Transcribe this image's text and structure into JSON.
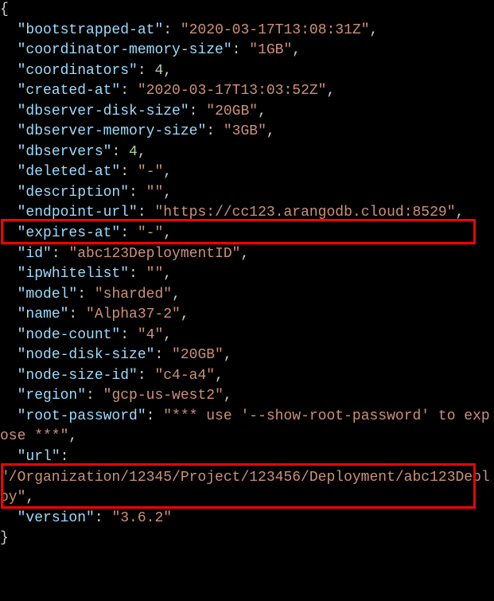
{
  "lines": [
    {
      "type": "brace",
      "text": "{"
    },
    {
      "type": "kv_str",
      "indent": "  ",
      "key": "bootstrapped-at",
      "value": "2020-03-17T13:08:31Z",
      "comma": true
    },
    {
      "type": "kv_str",
      "indent": "  ",
      "key": "coordinator-memory-size",
      "value": "1GB",
      "comma": true
    },
    {
      "type": "kv_num",
      "indent": "  ",
      "key": "coordinators",
      "value": "4",
      "comma": true
    },
    {
      "type": "kv_str",
      "indent": "  ",
      "key": "created-at",
      "value": "2020-03-17T13:03:52Z",
      "comma": true
    },
    {
      "type": "kv_str",
      "indent": "  ",
      "key": "dbserver-disk-size",
      "value": "20GB",
      "comma": true
    },
    {
      "type": "kv_str",
      "indent": "  ",
      "key": "dbserver-memory-size",
      "value": "3GB",
      "comma": true
    },
    {
      "type": "kv_num",
      "indent": "  ",
      "key": "dbservers",
      "value": "4",
      "comma": true
    },
    {
      "type": "kv_str",
      "indent": "  ",
      "key": "deleted-at",
      "value": "-",
      "comma": true
    },
    {
      "type": "kv_str",
      "indent": "  ",
      "key": "description",
      "value": "",
      "comma": true
    },
    {
      "type": "kv_str",
      "indent": "  ",
      "key": "endpoint-url",
      "value": "https://cc123.arangodb.cloud:8529",
      "comma": true
    },
    {
      "type": "kv_str",
      "indent": "  ",
      "key": "expires-at",
      "value": "-",
      "comma": true
    },
    {
      "type": "kv_str",
      "indent": "  ",
      "key": "id",
      "value": "abc123DeploymentID",
      "comma": true
    },
    {
      "type": "kv_str",
      "indent": "  ",
      "key": "ipwhitelist",
      "value": "",
      "comma": true
    },
    {
      "type": "kv_str",
      "indent": "  ",
      "key": "model",
      "value": "sharded",
      "comma": true
    },
    {
      "type": "kv_str",
      "indent": "  ",
      "key": "name",
      "value": "Alpha37-2",
      "comma": true
    },
    {
      "type": "kv_str",
      "indent": "  ",
      "key": "node-count",
      "value": "4",
      "comma": true
    },
    {
      "type": "kv_str",
      "indent": "  ",
      "key": "node-disk-size",
      "value": "20GB",
      "comma": true
    },
    {
      "type": "kv_str",
      "indent": "  ",
      "key": "node-size-id",
      "value": "c4-a4",
      "comma": true
    },
    {
      "type": "kv_str",
      "indent": "  ",
      "key": "region",
      "value": "gcp-us-west2",
      "comma": true
    },
    {
      "type": "kv_str_wrap",
      "indent": "  ",
      "key": "root-password",
      "value": "*** use '--show-root-password' to expose ***",
      "comma": true
    },
    {
      "type": "kv_str_wrap2",
      "indent": "  ",
      "key": "url",
      "value": "/Organization/12345/Project/123456/Deployment/abc123Deploy",
      "comma": true
    },
    {
      "type": "kv_str",
      "indent": "  ",
      "key": "version",
      "value": "3.6.2",
      "comma": false
    },
    {
      "type": "brace",
      "text": "}"
    }
  ]
}
